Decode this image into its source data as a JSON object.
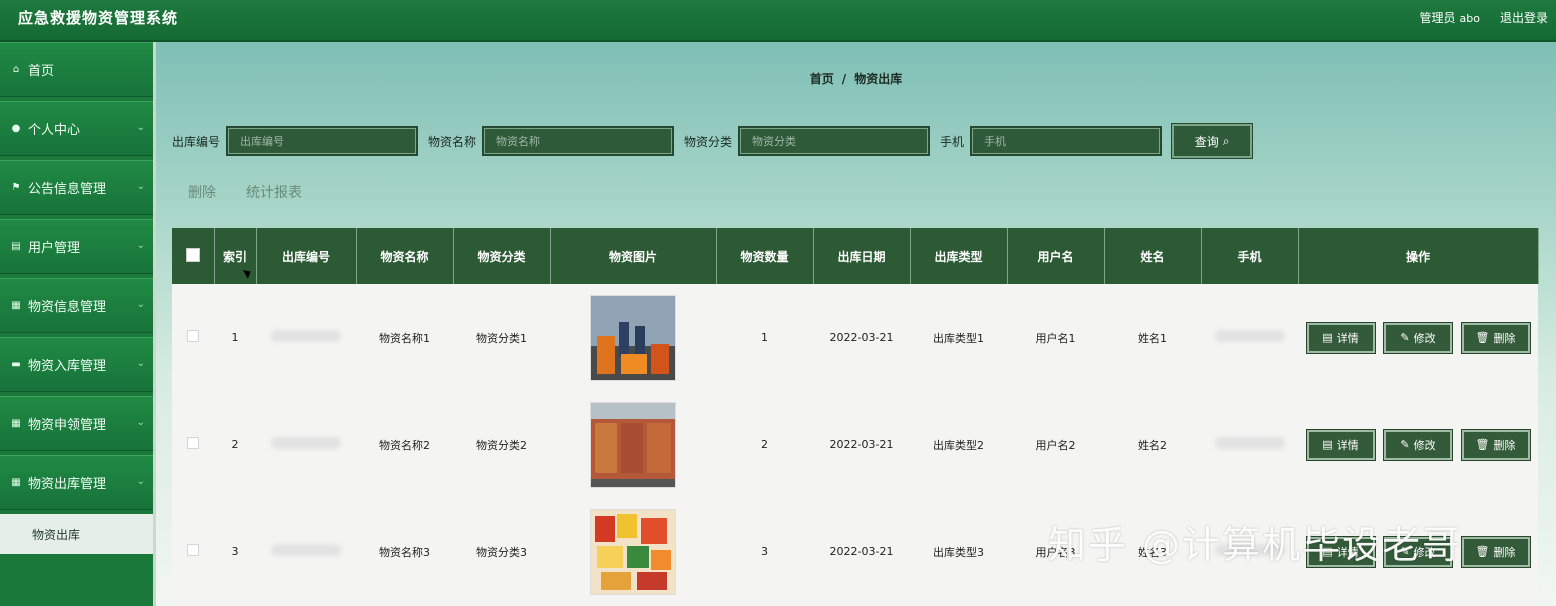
{
  "header": {
    "app_title": "应急救援物资管理系统",
    "user_label": "管理员",
    "user_name": "abo",
    "logout": "退出登录"
  },
  "sidebar": {
    "items": [
      {
        "label": "首页",
        "icon": "home-icon"
      },
      {
        "label": "个人中心",
        "icon": "user-icon"
      },
      {
        "label": "公告信息管理",
        "icon": "flag-icon"
      },
      {
        "label": "用户管理",
        "icon": "list-icon"
      },
      {
        "label": "物资信息管理",
        "icon": "grid-icon"
      },
      {
        "label": "物资入库管理",
        "icon": "chat-icon"
      },
      {
        "label": "物资申领管理",
        "icon": "grid-icon"
      },
      {
        "label": "物资出库管理",
        "icon": "grid-icon"
      }
    ],
    "submenu_active": "物资出库"
  },
  "breadcrumb": {
    "home": "首页",
    "sep": "/",
    "current": "物资出库"
  },
  "search": {
    "f1_label": "出库编号",
    "f1_placeholder": "出库编号",
    "f2_label": "物资名称",
    "f2_placeholder": "物资名称",
    "f3_label": "物资分类",
    "f3_placeholder": "物资分类",
    "f4_label": "手机",
    "f4_placeholder": "手机",
    "button": "查询"
  },
  "actions": {
    "delete": "删除",
    "report": "统计报表"
  },
  "table": {
    "headers": [
      "",
      "索引",
      "出库编号",
      "物资名称",
      "物资分类",
      "物资图片",
      "物资数量",
      "出库日期",
      "出库类型",
      "用户名",
      "姓名",
      "手机",
      "操作"
    ],
    "rows": [
      {
        "index": "1",
        "name": "物资名称1",
        "category": "物资分类1",
        "qty": "1",
        "date": "2022-03-21",
        "type": "出库类型1",
        "username": "用户名1",
        "realname": "姓名1"
      },
      {
        "index": "2",
        "name": "物资名称2",
        "category": "物资分类2",
        "qty": "2",
        "date": "2022-03-21",
        "type": "出库类型2",
        "username": "用户名2",
        "realname": "姓名2"
      },
      {
        "index": "3",
        "name": "物资名称3",
        "category": "物资分类3",
        "qty": "3",
        "date": "2022-03-21",
        "type": "出库类型3",
        "username": "用户名3",
        "realname": "姓名3"
      }
    ],
    "op_detail": "详情",
    "op_edit": "修改",
    "op_delete": "删除"
  },
  "watermark": "知乎 @计算机毕设老哥"
}
